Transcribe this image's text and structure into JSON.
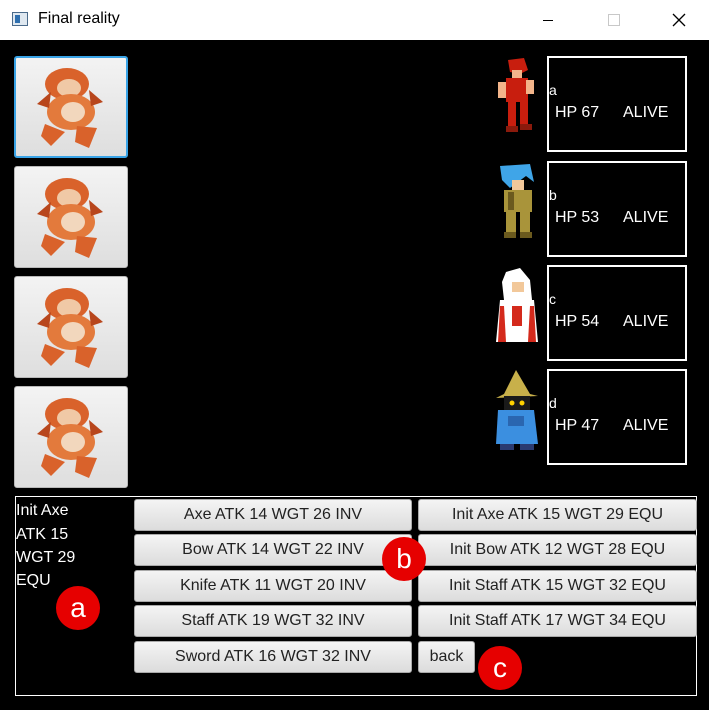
{
  "window": {
    "title": "Final reality"
  },
  "heroes": [
    {
      "name": "a",
      "hp": "HP 67",
      "status": "ALIVE"
    },
    {
      "name": "b",
      "hp": "HP 53",
      "status": "ALIVE"
    },
    {
      "name": "c",
      "hp": "HP 54",
      "status": "ALIVE"
    },
    {
      "name": "d",
      "hp": "HP 47",
      "status": "ALIVE"
    }
  ],
  "selected_weapon": {
    "name": "Init Axe",
    "atk": "ATK 15",
    "wgt": "WGT 29",
    "state": "EQU"
  },
  "inventory_left": [
    "Axe ATK 14 WGT 26 INV",
    "Bow ATK 14 WGT 22 INV",
    "Knife ATK 11 WGT 20 INV",
    "Staff ATK 19 WGT 32 INV",
    "Sword ATK 16 WGT 32 INV"
  ],
  "inventory_right": [
    "Init Axe ATK 15 WGT 29 EQU",
    "Init Bow ATK 12 WGT 28 EQU",
    "Init Staff ATK 15 WGT 32 EQU",
    "Init Staff ATK 17 WGT 34 EQU"
  ],
  "back_label": "back",
  "markers": {
    "a": "a",
    "b": "b",
    "c": "c"
  },
  "colors": {
    "marker": "#e60000",
    "focus": "#39a3e6",
    "background": "#000000"
  }
}
